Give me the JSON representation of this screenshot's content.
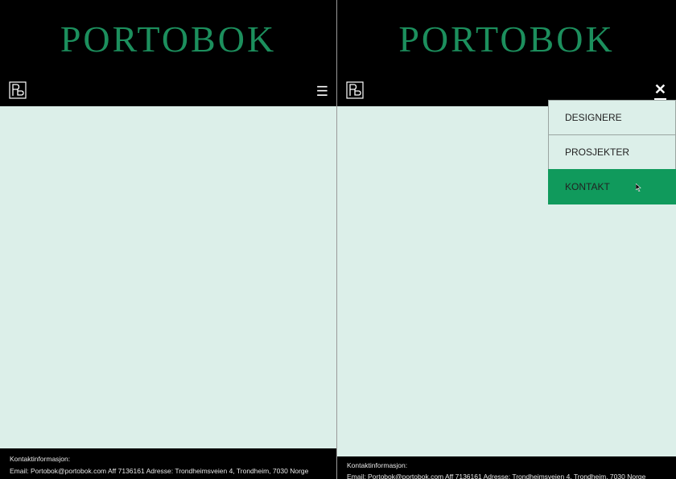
{
  "brand": {
    "name": "PORTOBOK",
    "color": "#1c8f5d"
  },
  "nav": {
    "menu_icon": "hamburger-icon",
    "close_icon": "close-icon",
    "logo_icon": "pb-logo-icon"
  },
  "menu": {
    "items": [
      {
        "label": "DESIGNERE",
        "active": false
      },
      {
        "label": "PROSJEKTER",
        "active": false
      },
      {
        "label": "KONTAKT",
        "active": true
      }
    ],
    "active_color": "#109a5c"
  },
  "content": {
    "background": "#dcefe9"
  },
  "footer": {
    "heading": "Kontaktinformasjon:",
    "info": "Email: Portobok@portobok.com  Aff 7136161 Adresse: Trondheimsveien 4, Trondheim, 7030 Norge"
  }
}
